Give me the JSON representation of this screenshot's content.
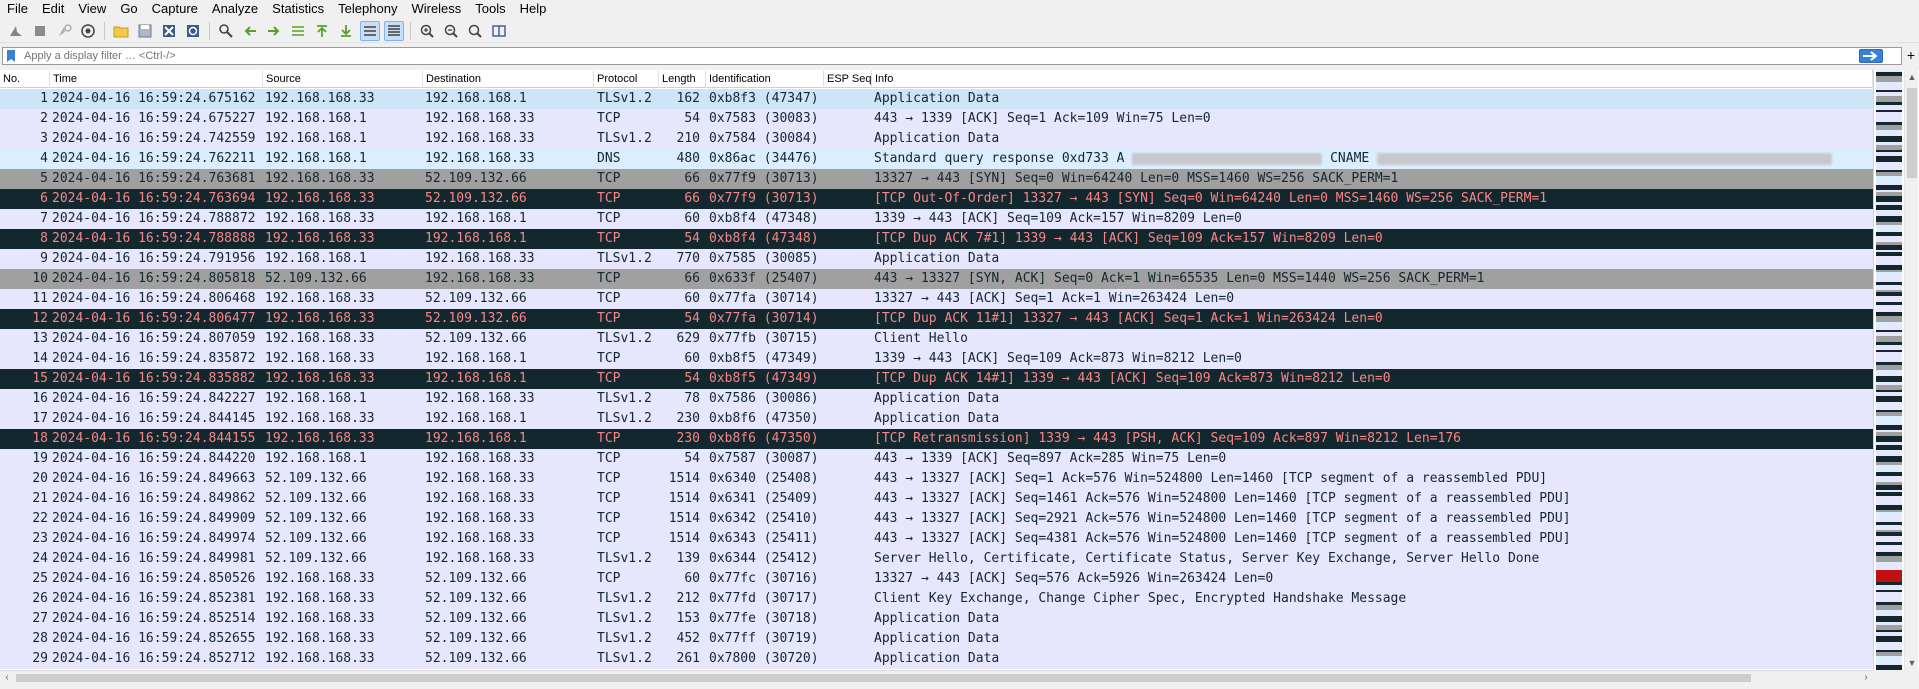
{
  "menu": [
    "File",
    "Edit",
    "View",
    "Go",
    "Capture",
    "Analyze",
    "Statistics",
    "Telephony",
    "Wireless",
    "Tools",
    "Help"
  ],
  "toolbar": {
    "icons": [
      "shark-fin-start-icon",
      "stop-capture-icon",
      "restart-capture-icon",
      "capture-options-icon",
      "open-file-icon",
      "save-file-icon",
      "close-file-icon",
      "reload-file-icon",
      "find-packet-icon",
      "go-back-icon",
      "go-forward-icon",
      "go-to-packet-icon",
      "go-first-icon",
      "go-last-icon",
      "autoscroll-icon",
      "colorize-icon",
      "zoom-in-icon",
      "zoom-out-icon",
      "normal-size-icon",
      "resize-columns-icon"
    ]
  },
  "filter": {
    "placeholder": "Apply a display filter … <Ctrl-/>",
    "value": "",
    "plus_label": "+"
  },
  "columns": [
    "No.",
    "Time",
    "Source",
    "Destination",
    "Protocol",
    "Length",
    "Identification",
    "ESP Seq",
    "Info"
  ],
  "packets": [
    {
      "no": "1",
      "time": "2024-04-16 16:59:24.675162",
      "src": "192.168.168.33",
      "dst": "192.168.168.1",
      "proto": "TLSv1.2",
      "len": "162",
      "ident": "0xb8f3 (47347)",
      "info": "Application Data",
      "color": "sel"
    },
    {
      "no": "2",
      "time": "2024-04-16 16:59:24.675227",
      "src": "192.168.168.1",
      "dst": "192.168.168.33",
      "proto": "TCP",
      "len": "54",
      "ident": "0x7583 (30083)",
      "info": "443 → 1339 [ACK] Seq=1 Ack=109 Win=75 Len=0",
      "color": "tcp"
    },
    {
      "no": "3",
      "time": "2024-04-16 16:59:24.742559",
      "src": "192.168.168.1",
      "dst": "192.168.168.33",
      "proto": "TLSv1.2",
      "len": "210",
      "ident": "0x7584 (30084)",
      "info": "Application Data",
      "color": "tls"
    },
    {
      "no": "4",
      "time": "2024-04-16 16:59:24.762211",
      "src": "192.168.168.1",
      "dst": "192.168.168.33",
      "proto": "DNS",
      "len": "480",
      "ident": "0x86ac (34476)",
      "info": "Standard query response 0xd733 A ",
      "info_tail": " CNAME ",
      "color": "dns"
    },
    {
      "no": "5",
      "time": "2024-04-16 16:59:24.763681",
      "src": "192.168.168.33",
      "dst": "52.109.132.66",
      "proto": "TCP",
      "len": "66",
      "ident": "0x77f9 (30713)",
      "info": "13327 → 443 [SYN] Seq=0 Win=64240 Len=0 MSS=1460 WS=256 SACK_PERM=1",
      "color": "syn"
    },
    {
      "no": "6",
      "time": "2024-04-16 16:59:24.763694",
      "src": "192.168.168.33",
      "dst": "52.109.132.66",
      "proto": "TCP",
      "len": "66",
      "ident": "0x77f9 (30713)",
      "info": "[TCP Out-Of-Order] 13327 → 443 [SYN] Seq=0 Win=64240 Len=0 MSS=1460 WS=256 SACK_PERM=1",
      "color": "bad"
    },
    {
      "no": "7",
      "time": "2024-04-16 16:59:24.788872",
      "src": "192.168.168.33",
      "dst": "192.168.168.1",
      "proto": "TCP",
      "len": "60",
      "ident": "0xb8f4 (47348)",
      "info": "1339 → 443 [ACK] Seq=109 Ack=157 Win=8209 Len=0",
      "color": "tcp"
    },
    {
      "no": "8",
      "time": "2024-04-16 16:59:24.788888",
      "src": "192.168.168.33",
      "dst": "192.168.168.1",
      "proto": "TCP",
      "len": "54",
      "ident": "0xb8f4 (47348)",
      "info": "[TCP Dup ACK 7#1] 1339 → 443 [ACK] Seq=109 Ack=157 Win=8209 Len=0",
      "color": "bad"
    },
    {
      "no": "9",
      "time": "2024-04-16 16:59:24.791956",
      "src": "192.168.168.1",
      "dst": "192.168.168.33",
      "proto": "TLSv1.2",
      "len": "770",
      "ident": "0x7585 (30085)",
      "info": "Application Data",
      "color": "tls"
    },
    {
      "no": "10",
      "time": "2024-04-16 16:59:24.805818",
      "src": "52.109.132.66",
      "dst": "192.168.168.33",
      "proto": "TCP",
      "len": "66",
      "ident": "0x633f (25407)",
      "info": "443 → 13327 [SYN, ACK] Seq=0 Ack=1 Win=65535 Len=0 MSS=1440 WS=256 SACK_PERM=1",
      "color": "syn"
    },
    {
      "no": "11",
      "time": "2024-04-16 16:59:24.806468",
      "src": "192.168.168.33",
      "dst": "52.109.132.66",
      "proto": "TCP",
      "len": "60",
      "ident": "0x77fa (30714)",
      "info": "13327 → 443 [ACK] Seq=1 Ack=1 Win=263424 Len=0",
      "color": "tcp"
    },
    {
      "no": "12",
      "time": "2024-04-16 16:59:24.806477",
      "src": "192.168.168.33",
      "dst": "52.109.132.66",
      "proto": "TCP",
      "len": "54",
      "ident": "0x77fa (30714)",
      "info": "[TCP Dup ACK 11#1] 13327 → 443 [ACK] Seq=1 Ack=1 Win=263424 Len=0",
      "color": "bad"
    },
    {
      "no": "13",
      "time": "2024-04-16 16:59:24.807059",
      "src": "192.168.168.33",
      "dst": "52.109.132.66",
      "proto": "TLSv1.2",
      "len": "629",
      "ident": "0x77fb (30715)",
      "info": "Client Hello",
      "color": "tls"
    },
    {
      "no": "14",
      "time": "2024-04-16 16:59:24.835872",
      "src": "192.168.168.33",
      "dst": "192.168.168.1",
      "proto": "TCP",
      "len": "60",
      "ident": "0xb8f5 (47349)",
      "info": "1339 → 443 [ACK] Seq=109 Ack=873 Win=8212 Len=0",
      "color": "tcp"
    },
    {
      "no": "15",
      "time": "2024-04-16 16:59:24.835882",
      "src": "192.168.168.33",
      "dst": "192.168.168.1",
      "proto": "TCP",
      "len": "54",
      "ident": "0xb8f5 (47349)",
      "info": "[TCP Dup ACK 14#1] 1339 → 443 [ACK] Seq=109 Ack=873 Win=8212 Len=0",
      "color": "bad"
    },
    {
      "no": "16",
      "time": "2024-04-16 16:59:24.842227",
      "src": "192.168.168.1",
      "dst": "192.168.168.33",
      "proto": "TLSv1.2",
      "len": "78",
      "ident": "0x7586 (30086)",
      "info": "Application Data",
      "color": "tls"
    },
    {
      "no": "17",
      "time": "2024-04-16 16:59:24.844145",
      "src": "192.168.168.33",
      "dst": "192.168.168.1",
      "proto": "TLSv1.2",
      "len": "230",
      "ident": "0xb8f6 (47350)",
      "info": "Application Data",
      "color": "tls"
    },
    {
      "no": "18",
      "time": "2024-04-16 16:59:24.844155",
      "src": "192.168.168.33",
      "dst": "192.168.168.1",
      "proto": "TCP",
      "len": "230",
      "ident": "0xb8f6 (47350)",
      "info": "[TCP Retransmission] 1339 → 443 [PSH, ACK] Seq=109 Ack=897 Win=8212 Len=176",
      "color": "bad"
    },
    {
      "no": "19",
      "time": "2024-04-16 16:59:24.844220",
      "src": "192.168.168.1",
      "dst": "192.168.168.33",
      "proto": "TCP",
      "len": "54",
      "ident": "0x7587 (30087)",
      "info": "443 → 1339 [ACK] Seq=897 Ack=285 Win=75 Len=0",
      "color": "tcp"
    },
    {
      "no": "20",
      "time": "2024-04-16 16:59:24.849663",
      "src": "52.109.132.66",
      "dst": "192.168.168.33",
      "proto": "TCP",
      "len": "1514",
      "ident": "0x6340 (25408)",
      "info": "443 → 13327 [ACK] Seq=1 Ack=576 Win=524800 Len=1460 [TCP segment of a reassembled PDU]",
      "color": "tcp"
    },
    {
      "no": "21",
      "time": "2024-04-16 16:59:24.849862",
      "src": "52.109.132.66",
      "dst": "192.168.168.33",
      "proto": "TCP",
      "len": "1514",
      "ident": "0x6341 (25409)",
      "info": "443 → 13327 [ACK] Seq=1461 Ack=576 Win=524800 Len=1460 [TCP segment of a reassembled PDU]",
      "color": "tcp"
    },
    {
      "no": "22",
      "time": "2024-04-16 16:59:24.849909",
      "src": "52.109.132.66",
      "dst": "192.168.168.33",
      "proto": "TCP",
      "len": "1514",
      "ident": "0x6342 (25410)",
      "info": "443 → 13327 [ACK] Seq=2921 Ack=576 Win=524800 Len=1460 [TCP segment of a reassembled PDU]",
      "color": "tcp"
    },
    {
      "no": "23",
      "time": "2024-04-16 16:59:24.849974",
      "src": "52.109.132.66",
      "dst": "192.168.168.33",
      "proto": "TCP",
      "len": "1514",
      "ident": "0x6343 (25411)",
      "info": "443 → 13327 [ACK] Seq=4381 Ack=576 Win=524800 Len=1460 [TCP segment of a reassembled PDU]",
      "color": "tcp"
    },
    {
      "no": "24",
      "time": "2024-04-16 16:59:24.849981",
      "src": "52.109.132.66",
      "dst": "192.168.168.33",
      "proto": "TLSv1.2",
      "len": "139",
      "ident": "0x6344 (25412)",
      "info": "Server Hello, Certificate, Certificate Status, Server Key Exchange, Server Hello Done",
      "color": "tls"
    },
    {
      "no": "25",
      "time": "2024-04-16 16:59:24.850526",
      "src": "192.168.168.33",
      "dst": "52.109.132.66",
      "proto": "TCP",
      "len": "60",
      "ident": "0x77fc (30716)",
      "info": "13327 → 443 [ACK] Seq=576 Ack=5926 Win=263424 Len=0",
      "color": "tcp"
    },
    {
      "no": "26",
      "time": "2024-04-16 16:59:24.852381",
      "src": "192.168.168.33",
      "dst": "52.109.132.66",
      "proto": "TLSv1.2",
      "len": "212",
      "ident": "0x77fd (30717)",
      "info": "Client Key Exchange, Change Cipher Spec, Encrypted Handshake Message",
      "color": "tls"
    },
    {
      "no": "27",
      "time": "2024-04-16 16:59:24.852514",
      "src": "192.168.168.33",
      "dst": "52.109.132.66",
      "proto": "TLSv1.2",
      "len": "153",
      "ident": "0x77fe (30718)",
      "info": "Application Data",
      "color": "tls"
    },
    {
      "no": "28",
      "time": "2024-04-16 16:59:24.852655",
      "src": "192.168.168.33",
      "dst": "52.109.132.66",
      "proto": "TLSv1.2",
      "len": "452",
      "ident": "0x77ff (30719)",
      "info": "Application Data",
      "color": "tls"
    },
    {
      "no": "29",
      "time": "2024-04-16 16:59:24.852712",
      "src": "192.168.168.33",
      "dst": "52.109.132.66",
      "proto": "TLSv1.2",
      "len": "261",
      "ident": "0x7800 (30720)",
      "info": "Application Data",
      "color": "tls"
    }
  ],
  "colors": {
    "tcp_bg": "#e7e6ff",
    "dns_bg": "#daeeff",
    "syn_bg": "#a0a0a0",
    "bad_bg": "#12272e",
    "bad_fg": "#f78787",
    "selected_bg": "#cfe3f9"
  }
}
